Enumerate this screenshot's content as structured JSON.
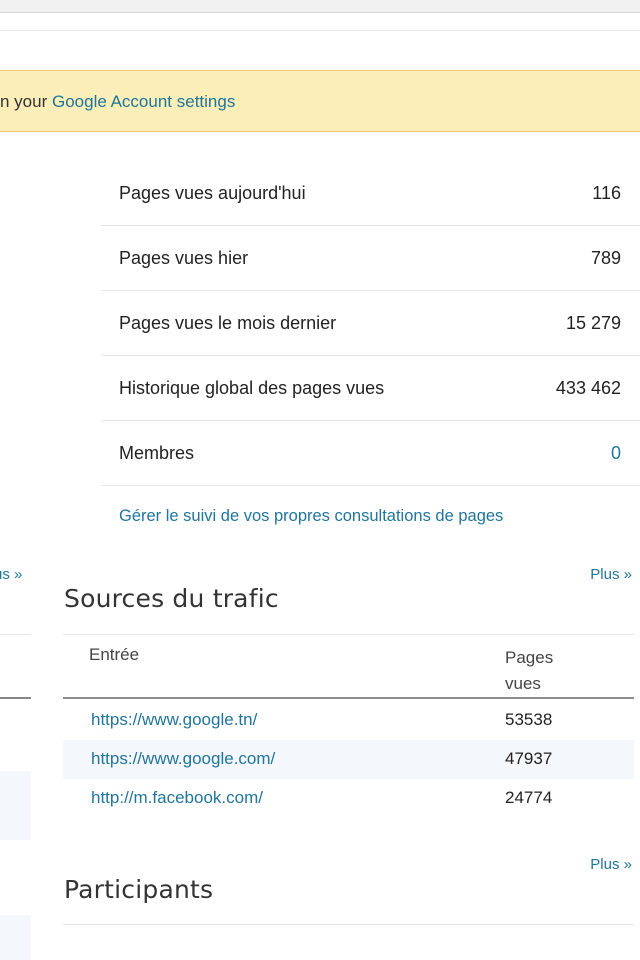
{
  "banner": {
    "prefix": "n your ",
    "link": "Google Account settings"
  },
  "stats": [
    {
      "label": "Pages vues aujourd'hui",
      "value": "116"
    },
    {
      "label": "Pages vues hier",
      "value": "789"
    },
    {
      "label": "Pages vues le mois dernier",
      "value": "15 279"
    },
    {
      "label": "Historique global des pages vues",
      "value": "433 462"
    },
    {
      "label": "Membres",
      "value": "0"
    }
  ],
  "manage_link": "Gérer le suivi de vos propres consultations de pages",
  "left_plus": "us »",
  "traffic": {
    "plus": "Plus »",
    "title": "Sources du trafic",
    "col_entry": "Entrée",
    "col_pages": "Pages vues",
    "rows": [
      {
        "url": "https://www.google.tn/",
        "views": "53538"
      },
      {
        "url": "https://www.google.com/",
        "views": "47937"
      },
      {
        "url": "http://m.facebook.com/",
        "views": "24774"
      }
    ]
  },
  "participants": {
    "plus": "Plus »",
    "title": "Participants"
  },
  "colors": {
    "link": "#21759b",
    "banner_bg": "#fbeeb8",
    "banner_border": "#f0c36d",
    "row_alt": "#f4f7fb"
  }
}
